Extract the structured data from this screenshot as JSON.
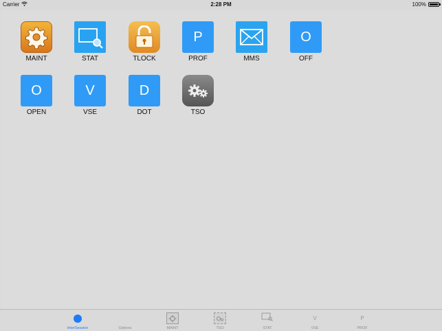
{
  "status_bar": {
    "carrier": "Carrier",
    "time": "2:28 PM",
    "battery": "100%",
    "battery_level": 1.0
  },
  "apps": [
    {
      "id": "maint",
      "label": "MAINT",
      "icon": "gear-icon"
    },
    {
      "id": "stat",
      "label": "STAT",
      "icon": "screen-magnifier-icon"
    },
    {
      "id": "tlock",
      "label": "TLOCK",
      "icon": "padlock-icon"
    },
    {
      "id": "prof",
      "label": "PROF",
      "letter": "P"
    },
    {
      "id": "mms",
      "label": "MMS",
      "icon": "envelope-icon"
    },
    {
      "id": "off",
      "label": "OFF",
      "letter": "O"
    },
    {
      "id": "open",
      "label": "OPEN",
      "letter": "O"
    },
    {
      "id": "vse",
      "label": "VSE",
      "letter": "V"
    },
    {
      "id": "dot",
      "label": "DOT",
      "letter": "D"
    },
    {
      "id": "tso",
      "label": "TSO",
      "icon": "gears-icon"
    }
  ],
  "tabs": [
    {
      "label": "InterSession",
      "active": true
    },
    {
      "label": "Options"
    },
    {
      "label": "MAINT"
    },
    {
      "label": "TSO"
    },
    {
      "label": "STAT"
    },
    {
      "label": "VSE",
      "letter": "V"
    },
    {
      "label": "PROF",
      "letter": "P"
    }
  ],
  "colors": {
    "accent": "#2f9bf6",
    "background": "#dcdcdc",
    "active_tab": "#2a7cf6"
  }
}
